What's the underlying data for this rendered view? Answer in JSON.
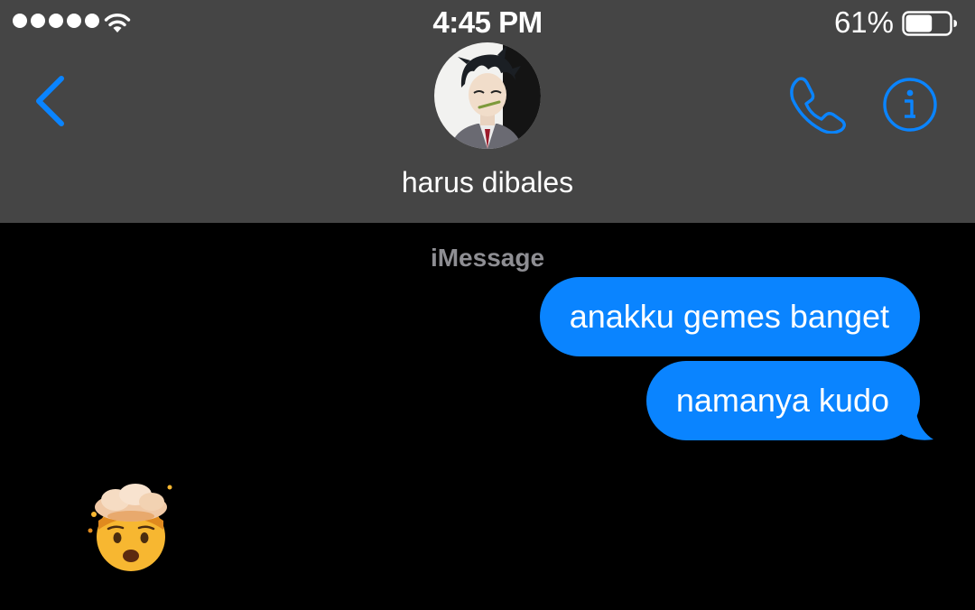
{
  "status_bar": {
    "signal_icon": "signal-dots-icon",
    "wifi_icon": "wifi-icon",
    "time": "4:45 PM",
    "battery_percent": "61%",
    "battery_level": 0.61,
    "battery_icon": "battery-icon"
  },
  "nav": {
    "back_icon": "chevron-left-icon",
    "contact_name": "harus dibales",
    "call_icon": "phone-icon",
    "info_icon": "info-icon",
    "accent_color": "#0a84ff"
  },
  "conversation": {
    "service_label": "iMessage",
    "messages": [
      {
        "sender": "me",
        "text": "anakku gemes banget"
      },
      {
        "sender": "me",
        "text": "namanya kudo"
      },
      {
        "sender": "them",
        "emoji": "exploding-head-emoji"
      }
    ]
  },
  "colors": {
    "header_bg": "#454545",
    "chat_bg": "#000000",
    "bubble_bg": "#0a84ff",
    "bubble_text": "#ffffff",
    "service_label": "#8e8e93"
  }
}
